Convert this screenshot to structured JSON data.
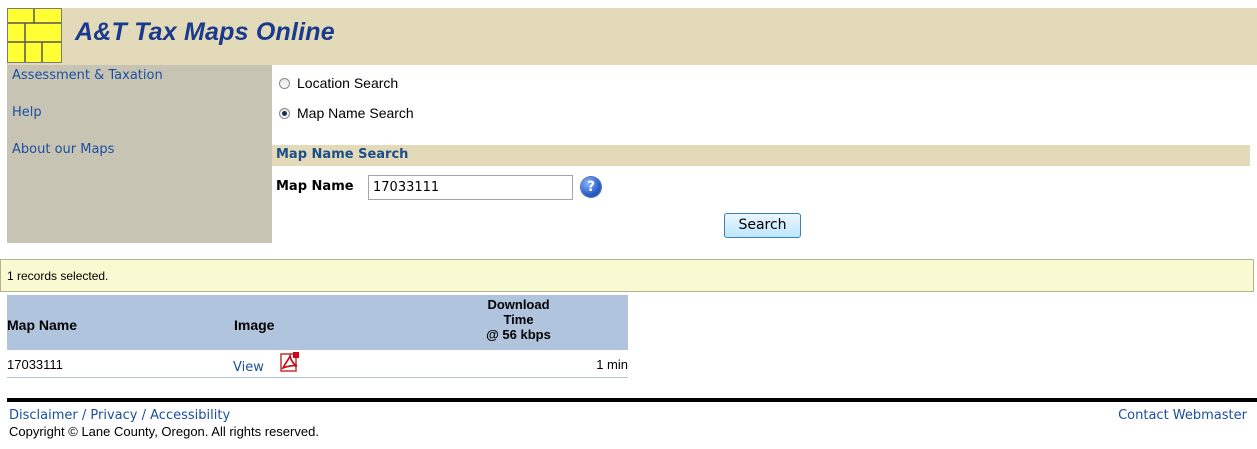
{
  "header": {
    "title": "A&T Tax Maps Online",
    "logo_icon": "map-grid-icon"
  },
  "sidebar": {
    "items": [
      {
        "label": "Assessment & Taxation"
      },
      {
        "label": "Help"
      },
      {
        "label": "About our Maps"
      }
    ]
  },
  "search_modes": {
    "options": [
      {
        "label": "Location Search",
        "selected": false
      },
      {
        "label": "Map Name Search",
        "selected": true
      }
    ]
  },
  "map_name_search": {
    "section_title": "Map Name Search",
    "field_label": "Map Name",
    "value": "17033111",
    "help_icon": "question-help-icon",
    "button_label": "Search"
  },
  "results": {
    "status": "1 records selected.",
    "columns": {
      "map_name": "Map Name",
      "image": "Image",
      "download_line1": "Download",
      "download_line2": "Time",
      "download_line3": "@ 56 kbps"
    },
    "rows": [
      {
        "map_name": "17033111",
        "image_link": "View",
        "image_icon": "pdf-icon",
        "download_time": "1 min"
      }
    ]
  },
  "footer": {
    "disclaimer": "Disclaimer",
    "separator": " / ",
    "privacy": "Privacy",
    "accessibility": "Accessibility",
    "copyright": "Copyright © Lane County, Oregon.  All rights reserved.",
    "contact": "Contact Webmaster"
  },
  "colors": {
    "header_bg": "#e2dab8",
    "sidebar_bg": "#c8c4b4",
    "title": "#1a3a8e",
    "link": "#1c4fa0",
    "table_header_bg": "#b0c4de",
    "status_bar_bg": "#fafad2"
  }
}
